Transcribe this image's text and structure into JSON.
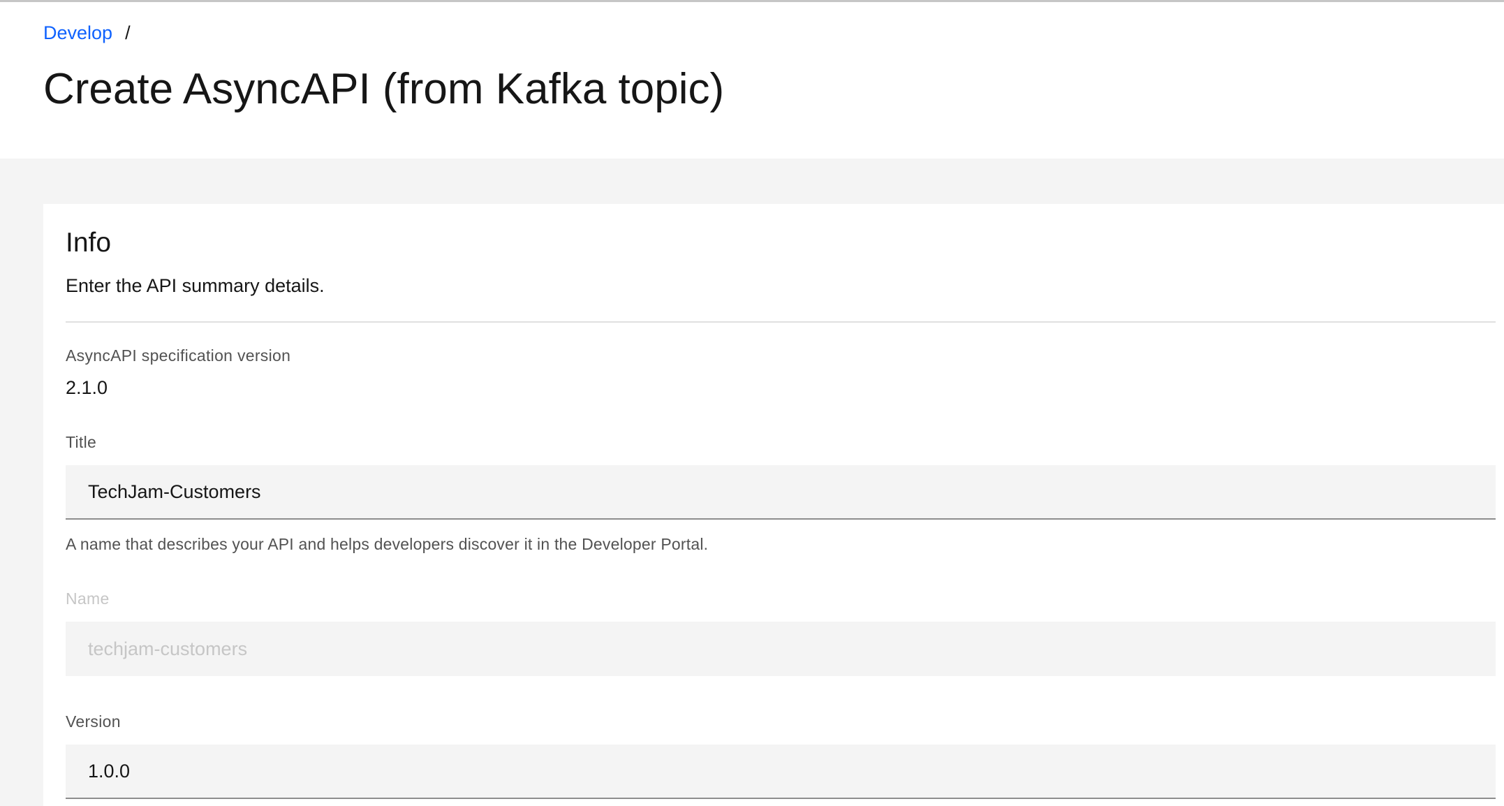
{
  "breadcrumb": {
    "link_label": "Develop",
    "separator": "/"
  },
  "page_title": "Create AsyncAPI (from Kafka topic)",
  "info_section": {
    "title": "Info",
    "description": "Enter the API summary details."
  },
  "fields": {
    "spec_version": {
      "label": "AsyncAPI specification version",
      "value": "2.1.0"
    },
    "title": {
      "label": "Title",
      "value": "TechJam-Customers",
      "helper": "A name that describes your API and helps developers discover it in the Developer Portal."
    },
    "name": {
      "label": "Name",
      "value": "techjam-customers",
      "disabled": true
    },
    "version": {
      "label": "Version",
      "value": "1.0.0"
    }
  },
  "colors": {
    "link": "#0f62fe",
    "text_primary": "#161616",
    "text_secondary": "#525252",
    "disabled": "#c6c6c6",
    "field_bg": "#f4f4f4",
    "page_bg": "#f4f4f4"
  }
}
